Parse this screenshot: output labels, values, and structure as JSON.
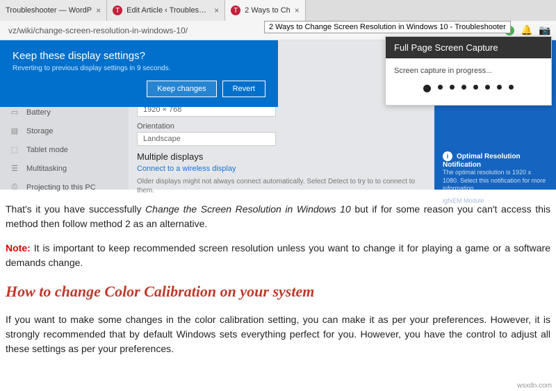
{
  "tabs": [
    {
      "title": "Troubleshooter — WordP"
    },
    {
      "title": "Edit Article ‹ Troubleshooter — W"
    },
    {
      "title": "2 Ways to Ch"
    }
  ],
  "tooltip": "2 Ways to Change Screen Resolution in Windows 10 - Troubleshooter",
  "url": "vz/wiki/change-screen-resolution-in-windows-10/",
  "dialog": {
    "title": "Keep these display settings?",
    "subtitle": "Reverting to previous display settings in  9 seconds.",
    "keep": "Keep changes",
    "revert": "Revert"
  },
  "sidebar": {
    "items": [
      {
        "icon": "▭",
        "label": "Battery"
      },
      {
        "icon": "▤",
        "label": "Storage"
      },
      {
        "icon": "⬚",
        "label": "Tablet mode"
      },
      {
        "icon": "☰",
        "label": "Multitasking"
      },
      {
        "icon": "⎙",
        "label": "Projecting to this PC"
      }
    ]
  },
  "settings": {
    "res_value": "1920 × 768",
    "orient_label": "Orientation",
    "orient_value": "Landscape",
    "multi_head": "Multiple displays",
    "multi_sub": "Connect to a wireless display",
    "multi_note": "Older displays might not always connect automatically. Select Detect to try to to connect to them."
  },
  "notification": {
    "title": "Optimal Resolution Notification",
    "body": "The optimal resolution is 1920 x 1080. Select this notification for more information.",
    "module": "igfxEM Module"
  },
  "capture": {
    "title": "Full Page Screen Capture",
    "status": "Screen capture in progress..."
  },
  "article": {
    "p1a": "That's it you have successfully ",
    "p1b": "Change the Screen Resolution in Windows 10",
    "p1c": " but if for some reason you can't access this method then follow method 2 as an alternative.",
    "note_label": "Note:",
    "note_body": " It is important to keep recommended screen resolution unless you want to change it for playing a game or a software demands change.",
    "h2": "How to change Color Calibration on your system",
    "p2": "If you want to make some changes in the color calibration setting, you can make it as per your preferences. However, it is strongly recommended that by default Windows sets everything perfect for you. However, you have the control to adjust all these settings as per your preferences."
  },
  "watermark": "wsxdn.com"
}
